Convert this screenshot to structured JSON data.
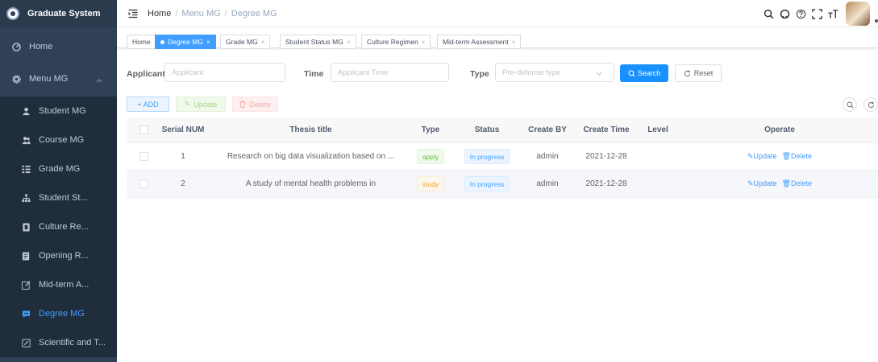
{
  "app": {
    "title": "Graduate System"
  },
  "sidebar": {
    "items": [
      {
        "label": "Home",
        "icon": "dashboard-icon"
      },
      {
        "label": "Menu MG",
        "icon": "gear-icon"
      },
      {
        "label": "Student MG",
        "icon": "user-icon"
      },
      {
        "label": "Course MG",
        "icon": "people-icon"
      },
      {
        "label": "Grade MG",
        "icon": "list-icon"
      },
      {
        "label": "Student St...",
        "icon": "tree-icon"
      },
      {
        "label": "Culture Re...",
        "icon": "book-icon"
      },
      {
        "label": "Opening R...",
        "icon": "document-icon"
      },
      {
        "label": "Mid-term A...",
        "icon": "edit-icon"
      },
      {
        "label": "Degree MG",
        "icon": "message-icon",
        "active": true
      },
      {
        "label": "Scientific and T...",
        "icon": "form-icon"
      }
    ]
  },
  "header": {
    "breadcrumb": [
      "Home",
      "Menu MG",
      "Degree MG"
    ],
    "separator": "/"
  },
  "tags": [
    {
      "label": "Home"
    },
    {
      "label": "Degree MG",
      "active": true
    },
    {
      "label": "Grade MG"
    },
    {
      "label": "Student Status MG"
    },
    {
      "label": "Culture Regimen"
    },
    {
      "label": "Mid-term Assessment"
    }
  ],
  "filter": {
    "applicant_label": "Applicant",
    "applicant_placeholder": "Applicant",
    "time_label": "Time",
    "time_placeholder": "Applicant Time",
    "type_label": "Type",
    "type_placeholder": "Pre-defense type",
    "search_label": "Search",
    "reset_label": "Reset"
  },
  "actions": {
    "add": "+ ADD",
    "update": "Update",
    "delete": "Delete"
  },
  "table": {
    "columns": [
      "Serial NUM",
      "Thesis title",
      "Type",
      "Status",
      "Create BY",
      "Create Time",
      "Level",
      "Operate"
    ],
    "rows": [
      {
        "serial": "1",
        "title": "Research on big data visualization based on ...",
        "type": "apply",
        "status": "In progress",
        "create_by": "admin",
        "create_time": "2021-12-28",
        "level": "",
        "op_update": "Update",
        "op_delete": "Delete"
      },
      {
        "serial": "2",
        "title": "A study of mental health problems in",
        "type": "study",
        "status": "In progress",
        "create_by": "admin",
        "create_time": "2021-12-28",
        "level": "",
        "op_update": "Update",
        "op_delete": "Delete"
      }
    ]
  },
  "colors": {
    "sidebar_bg": "#304156",
    "submenu_bg": "#1f2d3d",
    "accent": "#409eff",
    "primary_button": "#1890ff"
  }
}
